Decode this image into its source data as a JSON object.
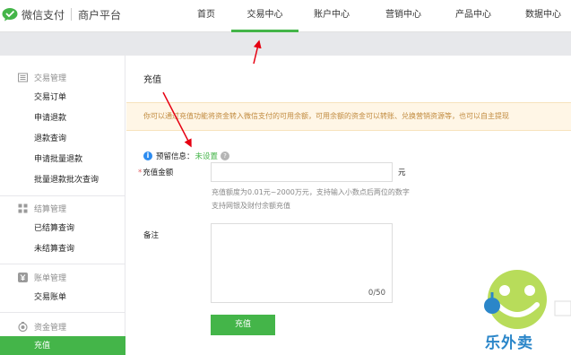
{
  "brand": {
    "name": "微信支付",
    "platform": "商户平台"
  },
  "nav": {
    "items": [
      {
        "label": "首页",
        "active": false
      },
      {
        "label": "交易中心",
        "active": true
      },
      {
        "label": "账户中心",
        "active": false
      },
      {
        "label": "营销中心",
        "active": false
      },
      {
        "label": "产品中心",
        "active": false
      },
      {
        "label": "数据中心",
        "active": false
      }
    ]
  },
  "sidebar": {
    "groups": [
      {
        "label": "交易管理",
        "icon": "list-icon",
        "items": [
          "交易订单",
          "申请退款",
          "退款查询",
          "申请批量退款",
          "批量退款批次查询"
        ]
      },
      {
        "label": "结算管理",
        "icon": "grid-icon",
        "items": [
          "已结算查询",
          "未结算查询"
        ]
      },
      {
        "label": "账单管理",
        "icon": "yen-icon",
        "items": [
          "交易账单"
        ]
      },
      {
        "label": "资金管理",
        "icon": "funds-icon",
        "items": [
          "充值"
        ]
      }
    ],
    "active_item": "充值"
  },
  "main": {
    "title": "充值",
    "tip": "你可以通过充值功能将资金转入微信支付的可用余额，可用余额的资金可以转账、兑换营销资源等，也可以自主提现",
    "reserve_label": "预留信息：",
    "reserve_value": "未设置",
    "amount_label": "充值金额",
    "amount_value": "",
    "unit": "元",
    "hint1": "充值额度为0.01元~2000万元，支持输入小数点后两位的数字",
    "hint2": "支持网银及财付余额充值",
    "remark_label": "备注",
    "remark_value": "",
    "remark_counter": "0/50",
    "submit_label": "充值"
  },
  "watermark": {
    "text": "乐外卖"
  },
  "colors": {
    "accent": "#44b549",
    "warning_bg": "#fff6e6",
    "warning_text": "#c08a3e",
    "annotation": "#e60012",
    "watermark": "#2b86c9"
  }
}
